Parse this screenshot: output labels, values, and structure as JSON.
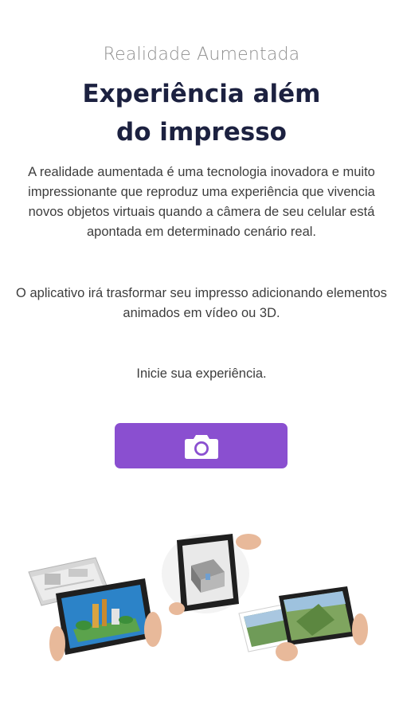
{
  "header": {
    "subtitle": "Realidade Aumentada",
    "title_line1": "Experiência além",
    "title_line2": "do impresso"
  },
  "body": {
    "paragraph1": "A realidade aumentada é uma tecnologia inovadora e muito impressionante que reproduz uma experiência que vivencia novos objetos virtuais quando a câmera de seu celular está apontada em determinado cenário real.",
    "paragraph2": "O aplicativo irá trasformar seu impresso adicionando elementos animados em vídeo ou 3D.",
    "cta_text": "Inicie sua experiência."
  },
  "camera_button": {
    "icon": "camera-icon",
    "color": "#8a4fd0"
  },
  "illustration": {
    "icon": "ar-tablets-illustration"
  }
}
